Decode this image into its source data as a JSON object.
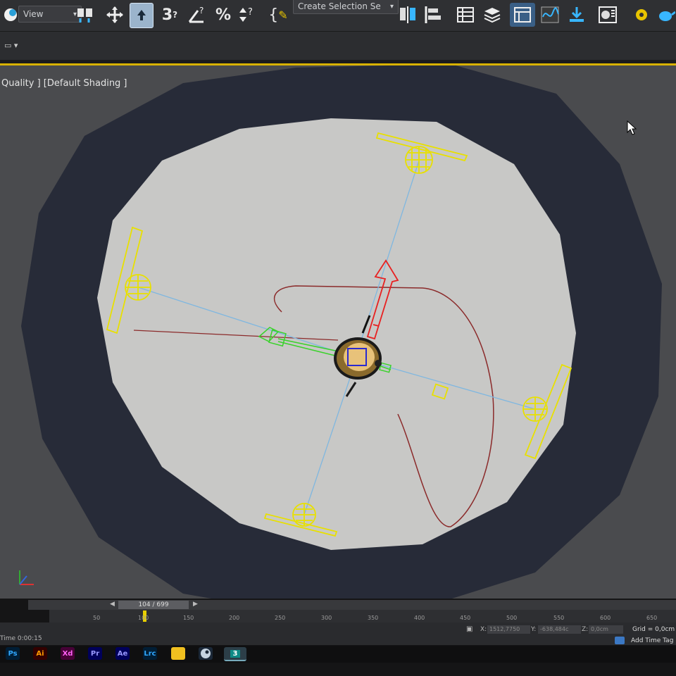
{
  "toolbar": {
    "view_dropdown": "View",
    "selection_set": "Create Selection Se",
    "icons": [
      "app-logo-icon",
      "select-link-icon",
      "move-icon",
      "select-object-icon",
      "snap-3d-icon",
      "angle-snap-icon",
      "percent-snap-icon",
      "spinner-snap-icon",
      "named-selection-icon",
      "mirror-icon",
      "align-icon",
      "scene-explorer-icon",
      "layer-explorer-icon",
      "ribbon-icon",
      "curve-editor-icon",
      "render-setup-icon",
      "material-editor-icon",
      "render-icon"
    ]
  },
  "viewport": {
    "label": "Quality ] [Default Shading ]"
  },
  "timeline": {
    "frame_counter": "104 / 699",
    "ticks": [
      "50",
      "100",
      "150",
      "200",
      "250",
      "300",
      "350",
      "400",
      "450",
      "500",
      "550",
      "600",
      "650"
    ]
  },
  "status": {
    "time": "Time  0:00:15",
    "x_label": "X:",
    "x_value": "1512,7750",
    "y_label": "Y:",
    "y_value": "-638,484c",
    "z_label": "Z:",
    "z_value": "0,0cm",
    "grid": "Grid = 0,0cm",
    "add_time_tag": "Add Time Tag"
  },
  "taskbar": {
    "apps": [
      {
        "label": "Ps",
        "color": "#31a8ff",
        "bg": "#001e36"
      },
      {
        "label": "Ai",
        "color": "#ff9a00",
        "bg": "#330000"
      },
      {
        "label": "Xd",
        "color": "#ff61f6",
        "bg": "#470137"
      },
      {
        "label": "Pr",
        "color": "#9999ff",
        "bg": "#00005b"
      },
      {
        "label": "Ae",
        "color": "#9999ff",
        "bg": "#00005b"
      },
      {
        "label": "Lrc",
        "color": "#31a8ff",
        "bg": "#001e36"
      }
    ]
  },
  "colors": {
    "accent": "#d9b200",
    "helper": "#e8e000",
    "path": "#8b2a2a",
    "link": "#7fb7e0"
  }
}
